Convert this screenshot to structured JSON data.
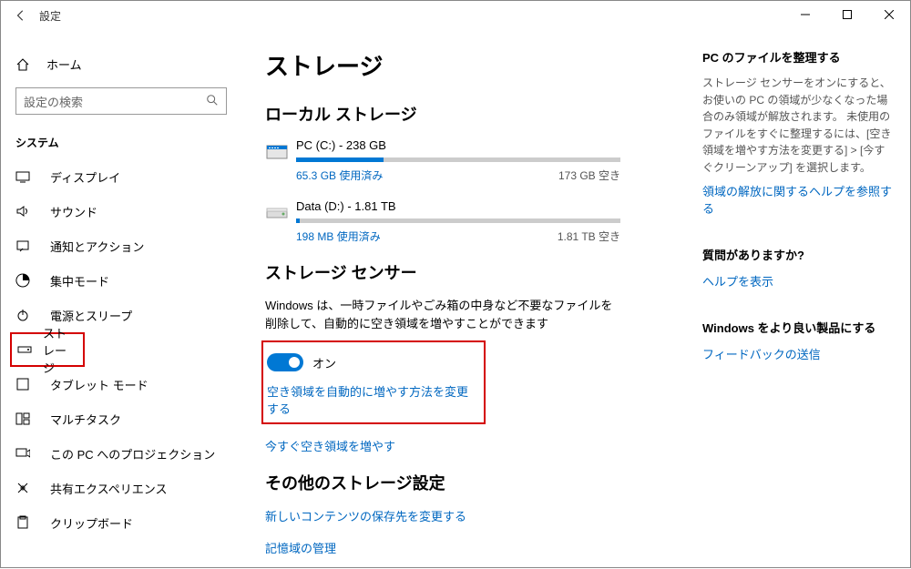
{
  "titlebar": {
    "title": "設定"
  },
  "sidebar": {
    "home": "ホーム",
    "search_placeholder": "設定の検索",
    "category": "システム",
    "items": [
      {
        "label": "ディスプレイ"
      },
      {
        "label": "サウンド"
      },
      {
        "label": "通知とアクション"
      },
      {
        "label": "集中モード"
      },
      {
        "label": "電源とスリープ"
      },
      {
        "label": "ストレージ"
      },
      {
        "label": "タブレット モード"
      },
      {
        "label": "マルチタスク"
      },
      {
        "label": "この PC へのプロジェクション"
      },
      {
        "label": "共有エクスペリエンス"
      },
      {
        "label": "クリップボード"
      }
    ]
  },
  "main": {
    "page_title": "ストレージ",
    "local_storage_hdr": "ローカル ストレージ",
    "drives": [
      {
        "name": "PC (C:) - 238 GB",
        "used": "65.3 GB 使用済み",
        "free": "173 GB 空き",
        "fill_pct": 27
      },
      {
        "name": "Data (D:) - 1.81 TB",
        "used": "198 MB 使用済み",
        "free": "1.81 TB 空き",
        "fill_pct": 1
      }
    ],
    "sense_hdr": "ストレージ センサー",
    "sense_desc": "Windows は、一時ファイルやごみ箱の中身など不要なファイルを削除して、自動的に空き領域を増やすことができます",
    "sense_state": "オン",
    "sense_change_link": "空き領域を自動的に増やす方法を変更する",
    "free_now_link": "今すぐ空き領域を増やす",
    "other_hdr": "その他のストレージ設定",
    "other_link1": "新しいコンテンツの保存先を変更する",
    "other_link2": "記憶域の管理"
  },
  "aside": {
    "sec1_hdr": "PC のファイルを整理する",
    "sec1_body": "ストレージ センサーをオンにすると、お使いの PC の領域が少なくなった場合のみ領域が解放されます。 未使用のファイルをすぐに整理するには、[空き領域を増やす方法を変更する] > [今すぐクリーンアップ] を選択します。",
    "sec1_link": "領域の解放に関するヘルプを参照する",
    "sec2_hdr": "質問がありますか?",
    "sec2_link": "ヘルプを表示",
    "sec3_hdr": "Windows をより良い製品にする",
    "sec3_link": "フィードバックの送信"
  }
}
